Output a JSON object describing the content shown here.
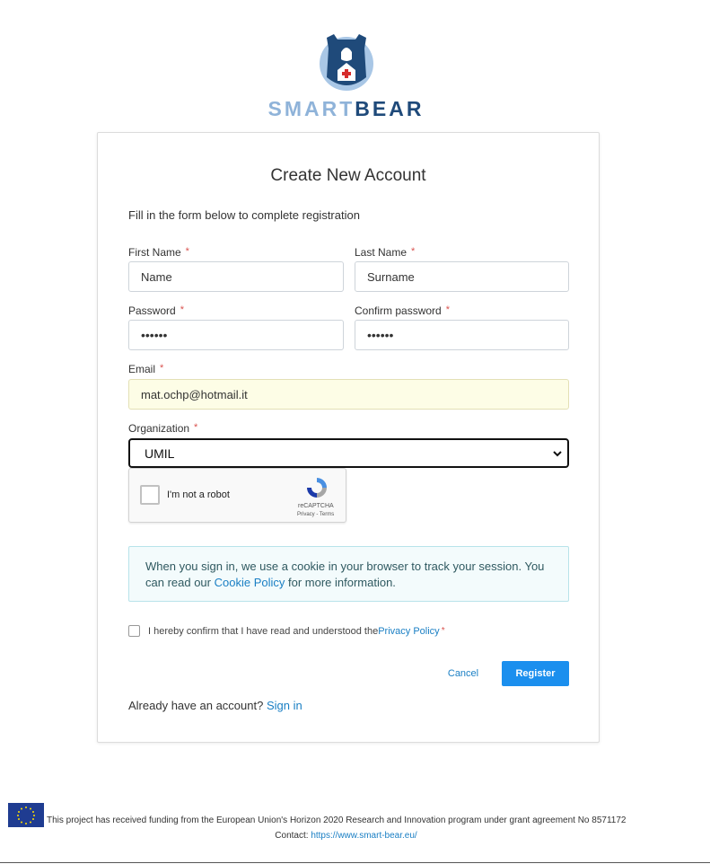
{
  "brand": {
    "part1": "SMART",
    "part2": "BEAR"
  },
  "form": {
    "title": "Create New Account",
    "subtitle": "Fill in the form below to complete registration",
    "required_mark": "*",
    "first_name": {
      "label": "First Name",
      "value": "Name"
    },
    "last_name": {
      "label": "Last Name",
      "value": "Surname"
    },
    "password": {
      "label": "Password",
      "value": "••••••"
    },
    "confirm_password": {
      "label": "Confirm password",
      "value": "••••••"
    },
    "email": {
      "label": "Email",
      "value": "mat.ochp@hotmail.it"
    },
    "organization": {
      "label": "Organization",
      "value": "UMIL"
    }
  },
  "captcha": {
    "label": "I'm not a robot",
    "brand": "reCAPTCHA",
    "links": "Privacy - Terms"
  },
  "info": {
    "text_before": "When you sign in, we use a cookie in your browser to track your session. You can read our ",
    "link": "Cookie Policy",
    "text_after": " for more information."
  },
  "confirm": {
    "text": "I hereby confirm that I have read and understood the ",
    "link": "Privacy Policy"
  },
  "actions": {
    "cancel": "Cancel",
    "register": "Register"
  },
  "signin": {
    "text": "Already have an account? ",
    "link": "Sign in"
  },
  "footer": {
    "funding": "This project has received funding from the European Union's Horizon 2020 Research and Innovation program under grant agreement No 8571172",
    "contact_label": "Contact: ",
    "contact_link": "https://www.smart-bear.eu/"
  },
  "colors": {
    "primary": "#1b8fee",
    "brand_dark": "#1f4a7a",
    "brand_light": "#8fb3d9",
    "required": "#d9534f"
  }
}
